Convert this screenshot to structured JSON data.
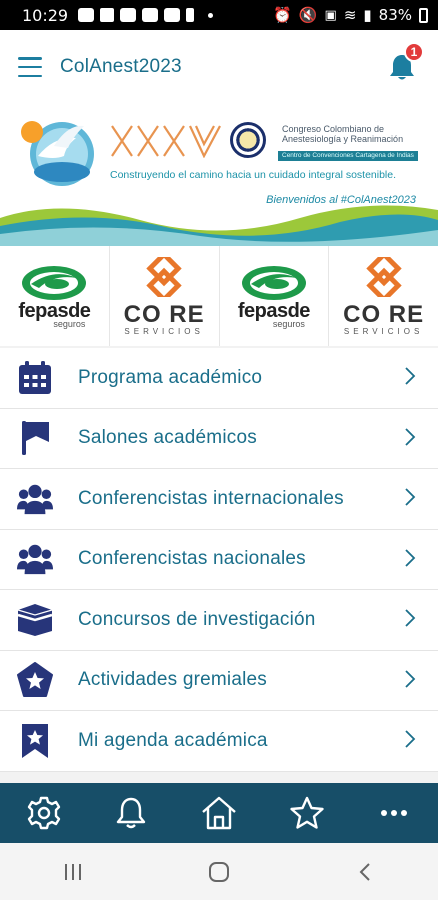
{
  "status_bar": {
    "time": "10:29",
    "battery": "83%"
  },
  "app_bar": {
    "title": "ColAnest2023",
    "notification_count": "1"
  },
  "banner": {
    "roman_numeral": "XXXV",
    "congress_line1": "Congreso Colombiano de",
    "congress_line2": "Anestesiología y Reanimación",
    "venue": "Centro de Convenciones Cartagena de Indias",
    "slogan": "Construyendo el camino hacia un cuidado integral sostenible.",
    "welcome": "Bienvenidos al #ColAnest2023"
  },
  "sponsors": [
    {
      "name": "fepasde",
      "sub": "seguros",
      "icon": "fepasde-logo"
    },
    {
      "name": "CO RE",
      "sub": "SERVICIOS",
      "icon": "core-logo"
    },
    {
      "name": "fepasde",
      "sub": "seguros",
      "icon": "fepasde-logo"
    },
    {
      "name": "CO RE",
      "sub": "SERVICIOS",
      "icon": "core-logo"
    }
  ],
  "menu": {
    "items": [
      {
        "label": "Programa académico",
        "icon": "calendar-icon"
      },
      {
        "label": "Salones académicos",
        "icon": "flag-icon"
      },
      {
        "label": "Conferencistas internacionales",
        "icon": "users-icon"
      },
      {
        "label": "Conferencistas nacionales",
        "icon": "users-icon"
      },
      {
        "label": "Concursos de investigación",
        "icon": "kaaba-icon"
      },
      {
        "label": "Actividades gremiales",
        "icon": "star-pentagon-icon"
      },
      {
        "label": "Mi agenda académica",
        "icon": "bookmark-star-icon"
      }
    ]
  },
  "tab_bar": {
    "tabs": [
      "settings-icon",
      "bell-icon",
      "home-icon",
      "star-icon",
      "more-icon"
    ]
  },
  "colors": {
    "primary": "#1a6e8a",
    "icon": "#27357a",
    "tabbar": "#174e68",
    "badge": "#e23b3b"
  }
}
